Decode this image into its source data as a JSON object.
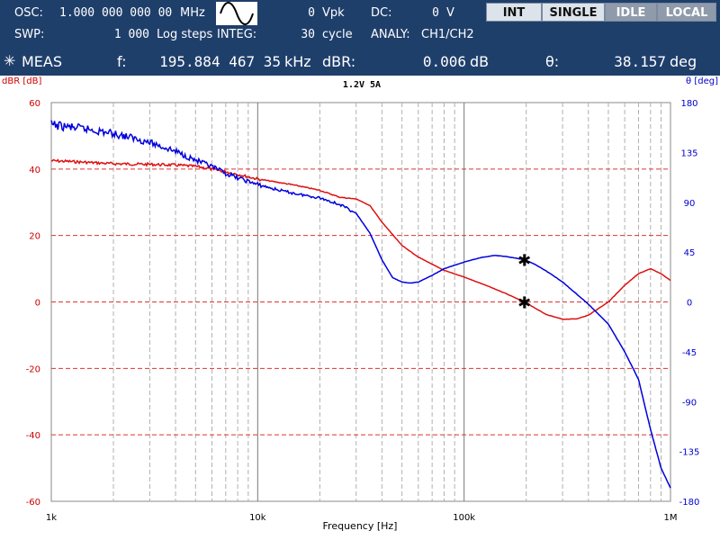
{
  "header": {
    "osc_label": "OSC:",
    "osc_value": "1.000 000 000 00",
    "osc_unit": "MHz",
    "waveform_icon": "sine-wave-icon",
    "amp_value": "0",
    "amp_unit": "Vpk",
    "dc_label": "DC:",
    "dc_value": "0",
    "dc_unit": "V",
    "swp_label": "SWP:",
    "swp_value": "1 000",
    "swp_mode": "Log steps",
    "integ_label": "INTEG:",
    "integ_value": "30",
    "integ_unit": "cycle",
    "analy_label": "ANALY:",
    "analy_value": "CH1/CH2",
    "meas_label": "MEAS",
    "f_label": "f:",
    "f_value": "195.884 467 35",
    "f_unit": "kHz",
    "dbr_label": "dBR:",
    "dbr_value": "0.006",
    "dbr_unit": "dB",
    "theta_label": "θ:",
    "theta_value": "38.157",
    "theta_unit": "deg"
  },
  "buttons": {
    "int": "INT",
    "single": "SINGLE",
    "idle": "IDLE",
    "local": "LOCAL"
  },
  "colors": {
    "header_bg": "#1f3f6b",
    "gain": "#dd1111",
    "phase": "#0000dd",
    "grid_red": "#dd3333",
    "grid_grey": "#b0b0b0"
  },
  "chart_data": {
    "type": "line",
    "title": "1.2V 5A",
    "xlabel": "Frequency [Hz]",
    "ylabel_left": "dBR [dB]",
    "ylabel_right": "θ [deg]",
    "xscale": "log",
    "xlim": [
      1000,
      1000000
    ],
    "xticks": [
      "1k",
      "10k",
      "100k",
      "1M"
    ],
    "ylim_left": [
      -60,
      60
    ],
    "yticks_left": [
      "60",
      "40",
      "20",
      "0",
      "-20",
      "-40",
      "-60"
    ],
    "ylim_right": [
      -180,
      180
    ],
    "yticks_right": [
      "180",
      "135",
      "90",
      "45",
      "0",
      "-45",
      "-90",
      "-135",
      "-180"
    ],
    "grid": true,
    "series": [
      {
        "axis": "left",
        "x": [
          1000,
          1200,
          1500,
          2000,
          3000,
          4000,
          5000,
          6000,
          7000,
          8000,
          10000,
          12000,
          15000,
          20000,
          25000,
          30000,
          35000,
          40000,
          50000,
          60000,
          80000,
          100000,
          130000,
          160000,
          195884,
          250000,
          300000,
          350000,
          400000,
          500000,
          600000,
          700000,
          800000,
          900000,
          1000000
        ],
        "y": [
          42.5,
          42.3,
          42.0,
          41.6,
          41.4,
          41.2,
          40.8,
          40.0,
          39.2,
          38.4,
          37.0,
          36.2,
          35.2,
          33.6,
          31.5,
          31.0,
          29.0,
          24.0,
          17.0,
          13.5,
          9.5,
          7.5,
          4.8,
          2.5,
          0.006,
          -3.8,
          -5.2,
          -5.1,
          -4.0,
          0.0,
          5.0,
          8.5,
          10.0,
          8.5,
          6.5
        ]
      },
      {
        "axis": "right",
        "x": [
          1000,
          1200,
          1500,
          2000,
          2500,
          3000,
          4000,
          5000,
          6000,
          7000,
          8000,
          10000,
          12000,
          15000,
          20000,
          25000,
          30000,
          35000,
          40000,
          45000,
          50000,
          55000,
          60000,
          70000,
          80000,
          100000,
          120000,
          140000,
          160000,
          195884,
          220000,
          250000,
          300000,
          400000,
          500000,
          600000,
          700000,
          800000,
          900000,
          1000000
        ],
        "y": [
          160,
          158,
          156,
          152,
          148,
          144,
          136,
          128,
          122,
          116,
          112,
          106,
          102,
          98,
          94,
          88,
          80,
          62,
          38,
          22,
          18,
          17,
          18,
          24,
          30,
          36,
          40,
          42,
          41,
          38.157,
          34,
          28,
          18,
          -2,
          -20,
          -45,
          -70,
          -115,
          -150,
          -168
        ]
      }
    ],
    "markers": [
      {
        "x": 195884,
        "y": 0.006,
        "axis": "left"
      },
      {
        "x": 195884,
        "y": 38.157,
        "axis": "right"
      }
    ]
  }
}
